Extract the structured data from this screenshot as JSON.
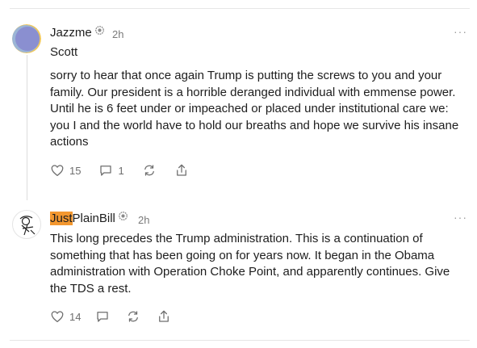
{
  "comments": [
    {
      "author_prefix": "",
      "author_highlight": "",
      "author_suffix": "Jazzme",
      "time": "2h",
      "more": "···",
      "greeting": "Scott",
      "body": "sorry to hear that once again Trump is putting the screws to you and your family. Our president is a horrible deranged individual with emmense power. Until he is 6 feet under or impeached or placed under institutional care we: you I and the world have to hold our breaths and hope we survive his insane actions",
      "likes": "15",
      "replies": "1"
    },
    {
      "author_prefix": "",
      "author_highlight": "Just",
      "author_suffix": "PlainBill",
      "time": "2h",
      "more": "···",
      "body": "This long precedes the Trump administration. This is a continuation of something that has been going on for years now. It began in the Obama administration with Operation Choke Point, and apparently continues. Give the TDS a rest.",
      "likes": "14",
      "replies": ""
    }
  ],
  "icons": {
    "badge": "gear-badge-icon",
    "like": "heart-icon",
    "reply": "comment-icon",
    "restack": "restack-icon",
    "share": "share-icon"
  },
  "colors": {
    "highlight": "#f3972f",
    "muted": "#7a7a7a"
  }
}
